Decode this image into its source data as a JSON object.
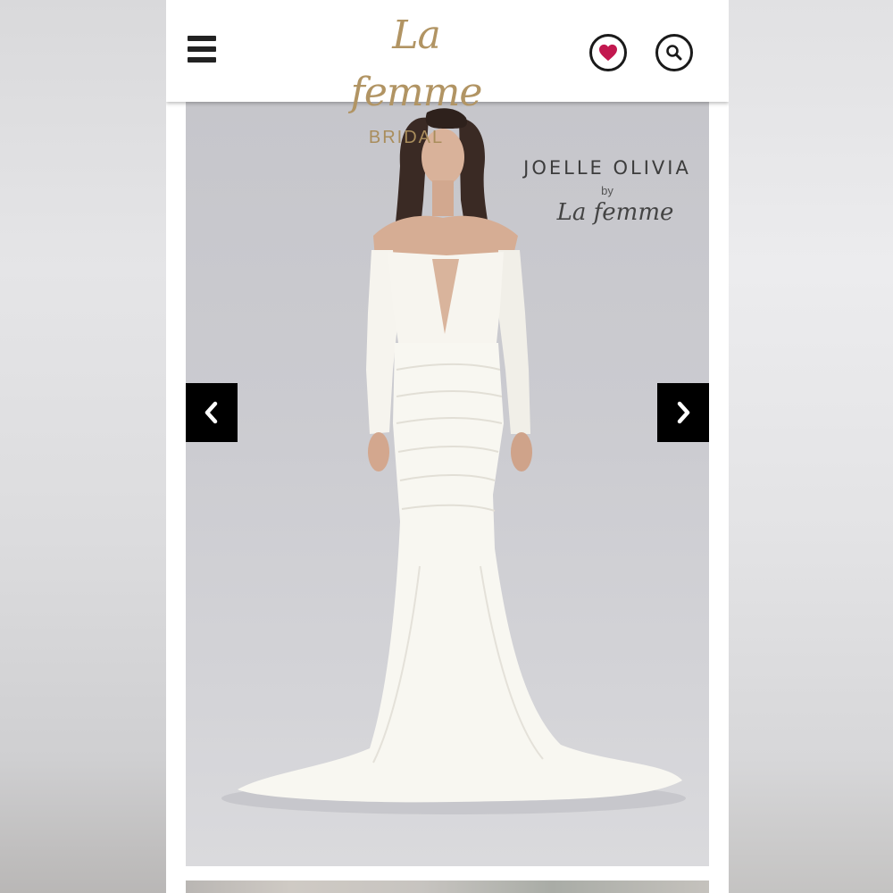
{
  "header": {
    "logo_script": "La femme",
    "logo_sub": "BRIDAL",
    "menu_icon": "hamburger-menu-icon",
    "favorites_icon": "heart-icon",
    "search_icon": "search-icon"
  },
  "hero": {
    "brand_name": "JOELLE OLIVIA",
    "brand_by": "by",
    "brand_script": "La femme",
    "prev_icon": "chevron-left-icon",
    "next_icon": "chevron-right-icon"
  },
  "colors": {
    "logo_gold": "#b19463",
    "heart_red": "#c2184f",
    "arrow_bg": "#000000",
    "hero_bg": "#c9c9ce"
  }
}
